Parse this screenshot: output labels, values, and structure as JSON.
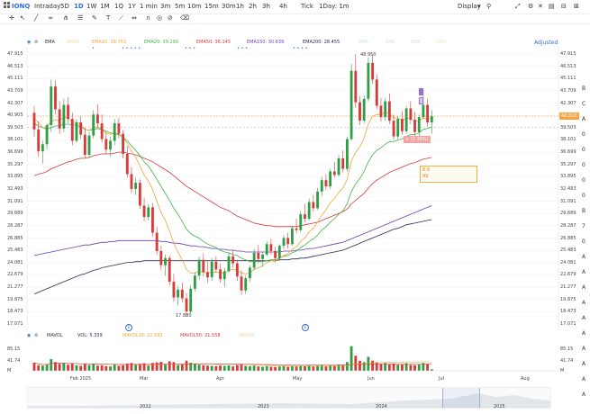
{
  "top": {
    "ticker": "IONQ",
    "timeframes": [
      "Intraday",
      "5D",
      "1D",
      "1W",
      "1M",
      "1Q",
      "1Y",
      "1 min",
      "3m",
      "5m",
      "10m",
      "15m",
      "30m",
      "1h",
      "2h",
      "3h",
      "4h",
      "Tick",
      "1Day: 1m"
    ],
    "active_timeframe": "1D",
    "display_label": "Display"
  },
  "indicators": {
    "ema_label": "EMA",
    "ema5": "EMA5",
    "ema10": "EMA10: 38.763",
    "ema20": "EMA20: 39.200",
    "ema50": "EMA50: 36.145",
    "ema150": "EMA150: 30.639",
    "ema200": "EMA200: 28.455",
    "faded1": "EMA",
    "faded2": "EMA",
    "faded3": "EMA",
    "faded4": "EMA",
    "adjusted": "Adjusted"
  },
  "price_axis": [
    "47.915",
    "46.513",
    "45.111",
    "43.709",
    "42.307",
    "40.905",
    "39.503",
    "38.101",
    "36.699",
    "35.297",
    "33.895",
    "32.493",
    "31.091",
    "29.689",
    "28.287",
    "26.885",
    "25.483",
    "24.081",
    "22.679",
    "21.277",
    "19.875",
    "18.473",
    "17.071"
  ],
  "price_ticks": [
    47.915,
    46.513,
    45.111,
    43.709,
    42.307,
    40.905,
    39.503,
    38.101,
    36.699,
    35.297,
    33.895,
    32.493,
    31.091,
    29.689,
    28.287,
    26.885,
    25.483,
    24.081,
    22.679,
    21.277,
    19.875,
    18.473,
    17.071
  ],
  "current_price_tag": "40.810",
  "current_price": 40.81,
  "low_label": "17.880",
  "high_label": "48.950",
  "annotation_box": {
    "line1": "8.9",
    "line2": "99"
  },
  "pct_badge": "+ (2.36%)",
  "mavol": {
    "label": "MAVOL",
    "vol": "VOL: 5.339",
    "ma20": "MAVOL20: 22.592",
    "ma50": "MAVOL50: 21.558",
    "faded": "MAVOL"
  },
  "vol_axis": [
    "85.15",
    "41.74",
    "M"
  ],
  "time_axis": [
    "Feb 2025",
    "Mar",
    "Apr",
    "May",
    "Jun",
    "Jul",
    "Aug"
  ],
  "overview_axis": [
    "2022",
    "2023",
    "2024",
    "2025"
  ],
  "side_letters": [
    "B",
    "C",
    "A",
    "0",
    "0",
    "0",
    "0",
    "0",
    "B",
    "7",
    "0",
    "A",
    "A",
    "A",
    "A",
    "A",
    "A",
    "A",
    "A",
    "A",
    "A"
  ],
  "colors": {
    "up": "#2e9e44",
    "down": "#d83a3a",
    "ema10": "#f0a43a",
    "ema20": "#3fb34a",
    "ema50": "#d43a3a",
    "ema150": "#6b3fb3",
    "ema200": "#2b2b55",
    "accent": "#2f70d8"
  },
  "chart_data": {
    "type": "candlestick",
    "ylim": [
      17.071,
      47.915
    ],
    "candles_ohlc": [
      [
        41.2,
        42.0,
        38.5,
        39.3
      ],
      [
        39.3,
        40.2,
        36.2,
        36.8
      ],
      [
        36.8,
        38.0,
        35.4,
        37.6
      ],
      [
        37.6,
        40.0,
        37.0,
        39.8
      ],
      [
        39.8,
        45.0,
        39.0,
        44.2
      ],
      [
        44.2,
        44.9,
        41.0,
        41.6
      ],
      [
        41.6,
        42.5,
        38.8,
        39.4
      ],
      [
        39.4,
        42.8,
        39.0,
        42.1
      ],
      [
        42.1,
        43.0,
        40.0,
        40.5
      ],
      [
        40.5,
        41.2,
        37.5,
        38.0
      ],
      [
        38.0,
        40.5,
        37.8,
        40.1
      ],
      [
        40.1,
        40.8,
        38.2,
        38.7
      ],
      [
        38.7,
        39.5,
        36.0,
        36.4
      ],
      [
        36.4,
        39.0,
        36.0,
        38.6
      ],
      [
        38.6,
        41.5,
        38.3,
        41.0
      ],
      [
        41.0,
        42.2,
        39.5,
        40.0
      ],
      [
        40.0,
        41.0,
        37.8,
        38.2
      ],
      [
        38.2,
        39.0,
        36.5,
        37.0
      ],
      [
        37.0,
        38.5,
        36.2,
        38.0
      ],
      [
        38.0,
        40.5,
        37.5,
        40.0
      ],
      [
        40.0,
        40.6,
        38.3,
        38.8
      ],
      [
        38.8,
        39.2,
        36.0,
        36.5
      ],
      [
        36.5,
        37.4,
        33.8,
        34.2
      ],
      [
        34.2,
        35.0,
        32.0,
        32.5
      ],
      [
        32.5,
        33.8,
        31.8,
        33.2
      ],
      [
        33.2,
        33.6,
        30.2,
        30.6
      ],
      [
        30.6,
        31.5,
        28.8,
        29.3
      ],
      [
        29.3,
        30.8,
        28.9,
        30.4
      ],
      [
        30.4,
        30.9,
        27.0,
        27.5
      ],
      [
        27.5,
        28.2,
        25.0,
        25.4
      ],
      [
        25.4,
        26.0,
        23.2,
        23.8
      ],
      [
        23.8,
        25.0,
        22.6,
        24.6
      ],
      [
        24.6,
        24.9,
        21.5,
        21.9
      ],
      [
        21.9,
        22.8,
        19.6,
        20.1
      ],
      [
        20.1,
        21.4,
        19.2,
        21.0
      ],
      [
        21.0,
        21.8,
        19.5,
        20.0
      ],
      [
        20.0,
        20.6,
        17.9,
        18.5
      ],
      [
        18.5,
        21.5,
        18.3,
        21.1
      ],
      [
        21.1,
        23.0,
        20.8,
        22.6
      ],
      [
        22.6,
        24.8,
        22.1,
        24.4
      ],
      [
        24.4,
        25.1,
        22.5,
        23.0
      ],
      [
        23.0,
        24.2,
        21.8,
        22.4
      ],
      [
        22.4,
        24.6,
        22.0,
        24.2
      ],
      [
        24.2,
        24.8,
        22.9,
        23.3
      ],
      [
        23.3,
        24.0,
        21.8,
        22.2
      ],
      [
        22.2,
        23.5,
        21.3,
        23.1
      ],
      [
        23.1,
        25.2,
        22.9,
        24.8
      ],
      [
        24.8,
        25.5,
        23.5,
        24.0
      ],
      [
        24.0,
        24.4,
        22.0,
        22.5
      ],
      [
        22.5,
        23.2,
        20.4,
        20.9
      ],
      [
        20.9,
        22.6,
        20.5,
        22.3
      ],
      [
        22.3,
        23.8,
        21.9,
        23.5
      ],
      [
        23.5,
        25.6,
        23.2,
        25.2
      ],
      [
        25.2,
        26.1,
        24.0,
        24.5
      ],
      [
        24.5,
        25.3,
        23.6,
        25.0
      ],
      [
        25.0,
        26.5,
        24.8,
        26.2
      ],
      [
        26.2,
        26.8,
        25.0,
        25.4
      ],
      [
        25.4,
        25.9,
        24.1,
        24.6
      ],
      [
        24.6,
        26.2,
        24.3,
        26.0
      ],
      [
        26.0,
        27.2,
        25.6,
        26.9
      ],
      [
        26.9,
        27.5,
        25.7,
        26.2
      ],
      [
        26.2,
        28.3,
        26.0,
        28.0
      ],
      [
        28.0,
        29.1,
        27.4,
        27.8
      ],
      [
        27.8,
        30.0,
        27.5,
        29.6
      ],
      [
        29.6,
        30.8,
        28.7,
        29.1
      ],
      [
        29.1,
        31.4,
        28.9,
        31.0
      ],
      [
        31.0,
        31.8,
        29.9,
        30.3
      ],
      [
        30.3,
        32.6,
        30.1,
        32.2
      ],
      [
        32.2,
        33.9,
        31.7,
        33.5
      ],
      [
        33.5,
        34.2,
        32.4,
        32.8
      ],
      [
        32.8,
        34.8,
        32.5,
        34.5
      ],
      [
        34.5,
        35.6,
        33.8,
        34.1
      ],
      [
        34.1,
        36.4,
        33.9,
        36.0
      ],
      [
        36.0,
        36.9,
        34.4,
        34.8
      ],
      [
        34.8,
        38.5,
        34.5,
        38.2
      ],
      [
        38.2,
        46.8,
        38.0,
        46.0
      ],
      [
        46.0,
        47.9,
        41.8,
        42.4
      ],
      [
        42.4,
        43.1,
        39.8,
        40.3
      ],
      [
        40.3,
        43.2,
        40.0,
        42.8
      ],
      [
        42.8,
        47.5,
        42.5,
        46.9
      ],
      [
        46.9,
        47.8,
        44.5,
        45.0
      ],
      [
        45.0,
        45.6,
        41.6,
        42.0
      ],
      [
        42.0,
        42.9,
        40.2,
        40.7
      ],
      [
        40.7,
        42.8,
        40.3,
        42.5
      ],
      [
        42.5,
        43.4,
        39.9,
        40.3
      ],
      [
        40.3,
        41.0,
        38.1,
        38.5
      ],
      [
        38.5,
        40.8,
        38.2,
        40.5
      ],
      [
        40.5,
        41.4,
        38.7,
        39.1
      ],
      [
        39.1,
        42.0,
        38.8,
        41.7
      ],
      [
        41.7,
        42.5,
        39.9,
        40.4
      ],
      [
        40.4,
        41.3,
        38.6,
        39.0
      ],
      [
        39.0,
        41.0,
        38.5,
        40.7
      ],
      [
        40.7,
        43.8,
        40.5,
        42.1
      ],
      [
        42.1,
        42.8,
        39.6,
        40.1
      ],
      [
        40.1,
        41.5,
        38.8,
        40.81
      ]
    ],
    "volume_m": [
      28,
      19,
      18,
      22,
      40,
      30,
      24,
      27,
      21,
      25,
      19,
      17,
      23,
      20,
      24,
      18,
      19,
      16,
      15,
      21,
      17,
      19,
      25,
      27,
      21,
      24,
      26,
      18,
      27,
      29,
      31,
      22,
      33,
      30,
      20,
      22,
      35,
      28,
      24,
      21,
      19,
      18,
      17,
      16,
      18,
      17,
      19,
      15,
      20,
      22,
      17,
      16,
      18,
      15,
      14,
      16,
      14,
      13,
      15,
      16,
      14,
      17,
      15,
      18,
      16,
      19,
      15,
      18,
      20,
      17,
      19,
      18,
      22,
      21,
      30,
      85,
      52,
      34,
      30,
      48,
      35,
      29,
      24,
      27,
      22,
      25,
      21,
      23,
      26,
      20,
      19,
      22,
      27,
      24,
      5.3
    ],
    "ema10": [
      40.5,
      40.1,
      39.5,
      39.5,
      40.2,
      40.4,
      40.3,
      40.7,
      40.6,
      40.1,
      40.1,
      39.9,
      39.3,
      39.2,
      39.5,
      39.6,
      39.3,
      38.9,
      38.7,
      38.9,
      38.8,
      38.4,
      37.7,
      36.8,
      36.1,
      35.1,
      34.1,
      33.4,
      32.4,
      31.1,
      29.8,
      28.9,
      27.7,
      26.3,
      25.3,
      24.4,
      23.3,
      22.9,
      22.9,
      23.1,
      23.0,
      22.9,
      23.0,
      23.0,
      22.9,
      22.9,
      23.2,
      23.3,
      23.2,
      22.9,
      22.8,
      22.9,
      23.3,
      23.5,
      23.7,
      24.1,
      24.3,
      24.3,
      24.5,
      24.9,
      25.1,
      25.6,
      25.9,
      26.5,
      26.9,
      27.6,
      28.0,
      28.7,
      29.5,
      30.1,
      30.9,
      31.4,
      32.1,
      32.6,
      33.6,
      35.7,
      36.7,
      37.3,
      38.3,
      39.9,
      40.8,
      41.0,
      41.0,
      41.3,
      41.1,
      40.6,
      40.6,
      40.3,
      40.6,
      40.5,
      40.2,
      40.3,
      40.6,
      40.5,
      40.6
    ],
    "ema20": [
      40.0,
      39.7,
      39.5,
      39.3,
      39.5,
      39.7,
      39.7,
      39.9,
      39.9,
      39.8,
      39.8,
      39.6,
      39.3,
      39.2,
      39.3,
      39.4,
      39.3,
      39.1,
      38.9,
      38.8,
      38.7,
      38.4,
      38.0,
      37.4,
      36.9,
      36.3,
      35.6,
      35.1,
      34.4,
      33.6,
      32.8,
      32.0,
      31.2,
      30.3,
      29.6,
      28.8,
      27.9,
      27.4,
      27.1,
      26.9,
      26.5,
      26.2,
      26.0,
      25.8,
      25.5,
      25.3,
      25.2,
      25.0,
      24.9,
      24.6,
      24.4,
      24.2,
      24.2,
      24.2,
      24.2,
      24.3,
      24.4,
      24.4,
      24.6,
      24.8,
      24.9,
      25.2,
      25.4,
      25.8,
      26.1,
      26.5,
      26.8,
      27.2,
      27.8,
      28.2,
      28.7,
      29.1,
      29.6,
      30.0,
      30.8,
      32.2,
      33.1,
      33.7,
      34.5,
      35.6,
      36.4,
      36.9,
      37.2,
      37.6,
      37.9,
      37.9,
      38.1,
      38.2,
      38.5,
      38.7,
      38.7,
      38.9,
      39.3,
      39.4,
      39.6
    ],
    "ema50": [
      34.0,
      34.2,
      34.3,
      34.5,
      34.8,
      35.0,
      35.2,
      35.4,
      35.6,
      35.7,
      35.9,
      36.0,
      36.0,
      36.1,
      36.3,
      36.4,
      36.5,
      36.5,
      36.5,
      36.6,
      36.7,
      36.7,
      36.6,
      36.5,
      36.4,
      36.2,
      36.0,
      35.8,
      35.6,
      35.3,
      35.0,
      34.7,
      34.4,
      34.0,
      33.6,
      33.2,
      32.8,
      32.5,
      32.2,
      31.9,
      31.6,
      31.3,
      31.0,
      30.7,
      30.4,
      30.2,
      30.0,
      29.7,
      29.4,
      29.2,
      29.0,
      28.8,
      28.6,
      28.5,
      28.4,
      28.3,
      28.3,
      28.2,
      28.2,
      28.2,
      28.2,
      28.2,
      28.2,
      28.3,
      28.4,
      28.5,
      28.6,
      28.7,
      28.9,
      29.1,
      29.3,
      29.5,
      29.7,
      29.9,
      30.2,
      30.8,
      31.2,
      31.6,
      32.0,
      32.6,
      33.1,
      33.5,
      33.8,
      34.1,
      34.4,
      34.6,
      34.8,
      35.0,
      35.2,
      35.4,
      35.5,
      35.7,
      35.9,
      36.0,
      36.1
    ],
    "ema150": [
      24.9,
      25.0,
      25.1,
      25.2,
      25.3,
      25.4,
      25.5,
      25.6,
      25.7,
      25.8,
      25.9,
      26.0,
      26.1,
      26.1,
      26.2,
      26.3,
      26.4,
      26.4,
      26.5,
      26.5,
      26.6,
      26.6,
      26.6,
      26.6,
      26.6,
      26.6,
      26.6,
      26.6,
      26.6,
      26.6,
      26.5,
      26.5,
      26.4,
      26.3,
      26.3,
      26.2,
      26.1,
      26.0,
      26.0,
      25.9,
      25.9,
      25.8,
      25.7,
      25.7,
      25.6,
      25.6,
      25.5,
      25.5,
      25.4,
      25.4,
      25.3,
      25.3,
      25.3,
      25.3,
      25.3,
      25.3,
      25.3,
      25.3,
      25.3,
      25.4,
      25.4,
      25.4,
      25.5,
      25.5,
      25.6,
      25.7,
      25.7,
      25.8,
      25.9,
      26.0,
      26.1,
      26.2,
      26.3,
      26.4,
      26.6,
      26.8,
      27.0,
      27.2,
      27.4,
      27.6,
      27.8,
      28.0,
      28.2,
      28.4,
      28.6,
      28.8,
      29.0,
      29.2,
      29.4,
      29.6,
      29.8,
      30.0,
      30.2,
      30.4,
      30.6
    ],
    "ema200": [
      20.5,
      20.7,
      20.9,
      21.1,
      21.3,
      21.5,
      21.7,
      21.9,
      22.1,
      22.3,
      22.5,
      22.7,
      22.8,
      23.0,
      23.2,
      23.3,
      23.5,
      23.6,
      23.7,
      23.8,
      23.9,
      24.0,
      24.1,
      24.1,
      24.2,
      24.2,
      24.3,
      24.3,
      24.3,
      24.3,
      24.3,
      24.3,
      24.3,
      24.3,
      24.3,
      24.3,
      24.3,
      24.3,
      24.3,
      24.3,
      24.3,
      24.3,
      24.3,
      24.3,
      24.3,
      24.3,
      24.3,
      24.3,
      24.3,
      24.3,
      24.3,
      24.3,
      24.3,
      24.3,
      24.3,
      24.3,
      24.3,
      24.3,
      24.4,
      24.4,
      24.4,
      24.5,
      24.5,
      24.6,
      24.6,
      24.7,
      24.8,
      24.9,
      25.0,
      25.1,
      25.2,
      25.3,
      25.4,
      25.5,
      25.7,
      25.9,
      26.1,
      26.3,
      26.5,
      26.7,
      26.9,
      27.1,
      27.3,
      27.5,
      27.7,
      27.9,
      28.0,
      28.2,
      28.4,
      28.5,
      28.6,
      28.7,
      28.8,
      28.9,
      29.0
    ]
  }
}
